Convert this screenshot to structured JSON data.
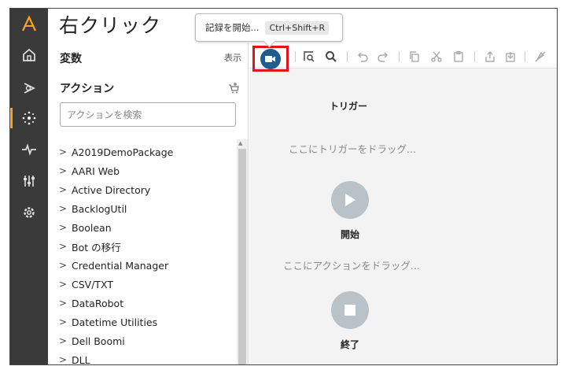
{
  "window": {
    "title": "右クリック"
  },
  "nav": {
    "items": [
      "logo-icon",
      "home-icon",
      "bot-icon",
      "activity-icon",
      "pulse-icon",
      "sliders-icon",
      "settings-icon"
    ],
    "active_index": 3,
    "accent": "#f7a521"
  },
  "variables": {
    "header": "変数",
    "link": "表示"
  },
  "actions": {
    "header": "アクション",
    "search_placeholder": "アクションを検索",
    "items": [
      "A2019DemoPackage",
      "AARI Web",
      "Active Directory",
      "BacklogUtil",
      "Boolean",
      "Bot の移行",
      "Credential Manager",
      "CSV/TXT",
      "DataRobot",
      "Datetime Utilities",
      "Dell Boomi",
      "DLL"
    ]
  },
  "tooltip": {
    "text": "記録を開始...",
    "shortcut": "Ctrl+Shift+R"
  },
  "flow": {
    "trigger_label": "トリガー",
    "trigger_hint": "ここにトリガーをドラッグ...",
    "start_label": "開始",
    "action_hint": "ここにアクションをドラッグ...",
    "end_label": "終了"
  },
  "colors": {
    "record": "#1f5d8c",
    "highlight": "#e0141e",
    "nav_bg": "#3a3a3a"
  }
}
